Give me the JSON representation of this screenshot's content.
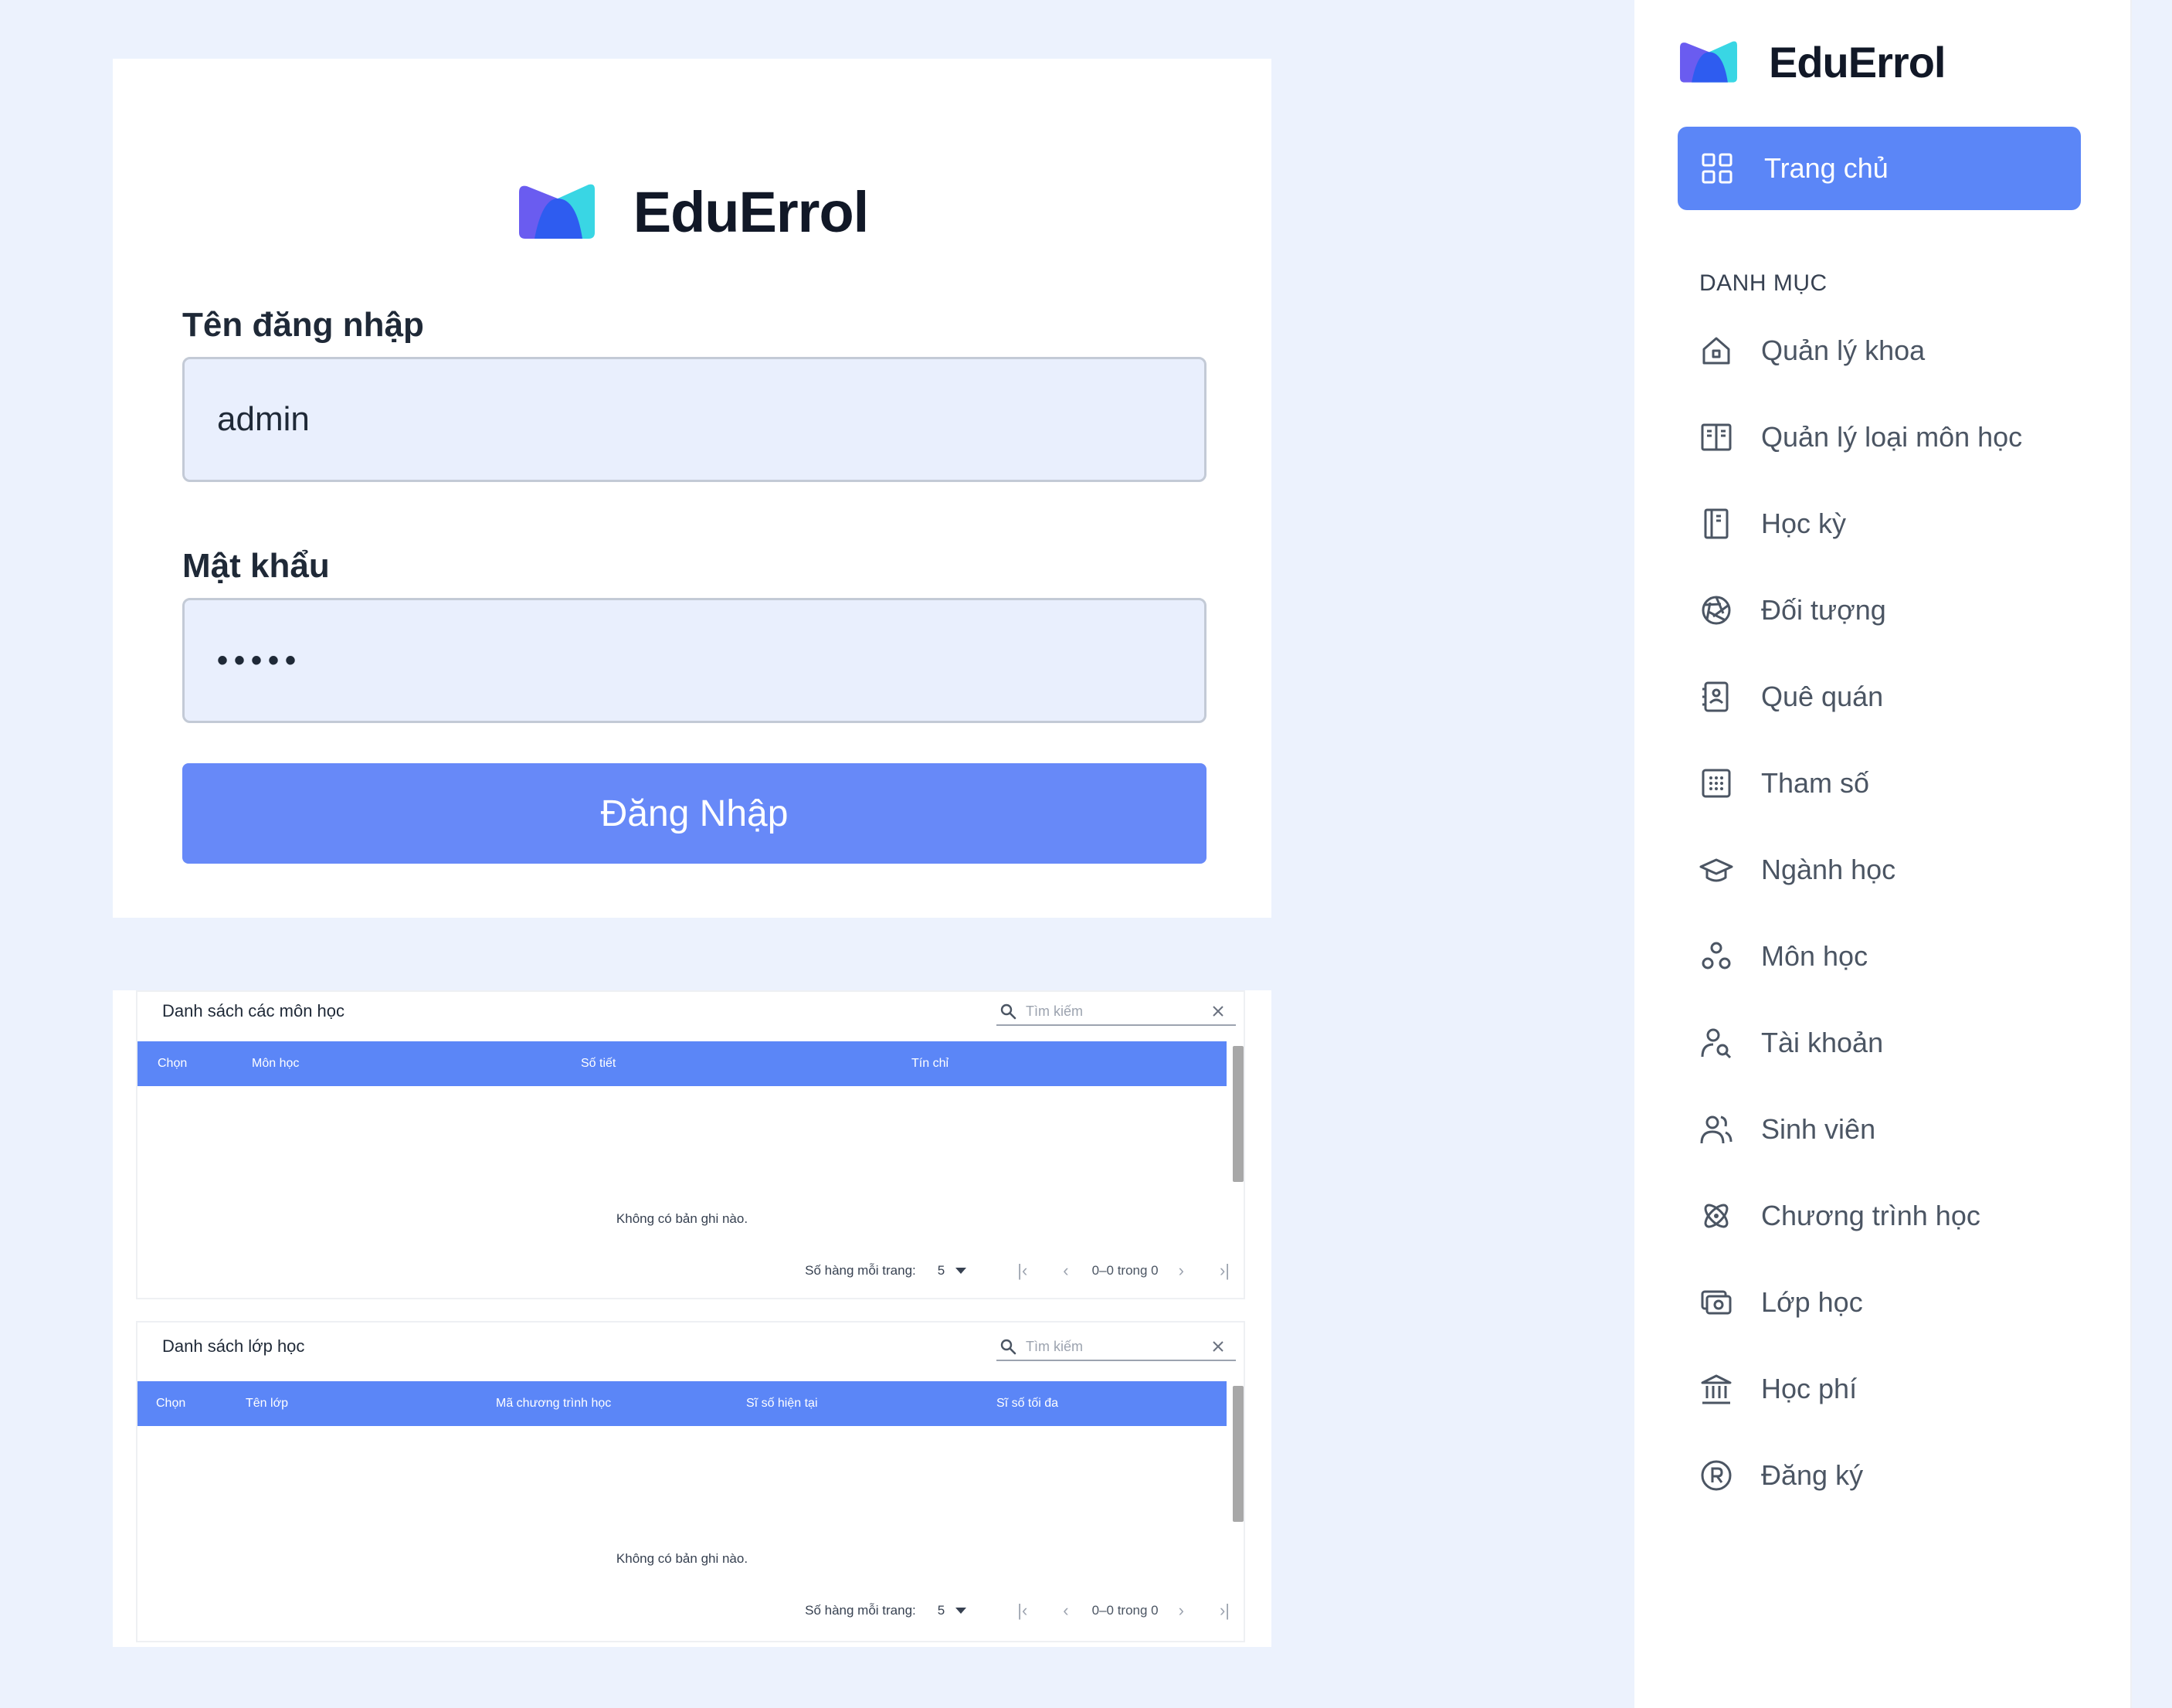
{
  "brand": {
    "name": "EduErrol"
  },
  "login": {
    "username_label": "Tên đăng nhập",
    "username_value": "admin",
    "password_label": "Mật khẩu",
    "password_value": "•••••",
    "submit_label": "Đăng Nhập"
  },
  "subjects_table": {
    "title": "Danh sách các môn học",
    "search_placeholder": "Tìm kiếm",
    "columns": [
      "Chọn",
      "Môn học",
      "Số tiết",
      "Tín chỉ"
    ],
    "empty_message": "Không có bản ghi nào.",
    "rows_per_page_label": "Số hàng mỗi trang:",
    "rows_per_page_value": "5",
    "range_text": "0–0 trong 0"
  },
  "classes_table": {
    "title": "Danh sách lớp học",
    "search_placeholder": "Tìm kiếm",
    "columns": [
      "Chọn",
      "Tên lớp",
      "Mã chương trình học",
      "Sĩ số hiện tại",
      "Sĩ số tối đa"
    ],
    "empty_message": "Không có bản ghi nào.",
    "rows_per_page_label": "Số hàng mỗi trang:",
    "rows_per_page_value": "5",
    "range_text": "0–0 trong 0"
  },
  "sidebar": {
    "home_label": "Trang chủ",
    "section_label": "DANH MỤC",
    "items": [
      {
        "label": "Quản lý khoa",
        "icon": "home-icon"
      },
      {
        "label": "Quản lý loại môn học",
        "icon": "book-open-icon"
      },
      {
        "label": "Học kỳ",
        "icon": "notebook-icon"
      },
      {
        "label": "Đối tượng",
        "icon": "aperture-icon"
      },
      {
        "label": "Quê quán",
        "icon": "contact-book-icon"
      },
      {
        "label": "Tham số",
        "icon": "grid-dots-icon"
      },
      {
        "label": "Ngành học",
        "icon": "graduation-cap-icon"
      },
      {
        "label": "Môn học",
        "icon": "shapes-icon"
      },
      {
        "label": "Tài khoản",
        "icon": "user-search-icon"
      },
      {
        "label": "Sinh viên",
        "icon": "users-icon"
      },
      {
        "label": "Chương trình học",
        "icon": "atom-icon"
      },
      {
        "label": "Lớp học",
        "icon": "money-cards-icon"
      },
      {
        "label": "Học phí",
        "icon": "bank-icon"
      },
      {
        "label": "Đăng ký",
        "icon": "registered-icon"
      }
    ]
  },
  "colors": {
    "page_background": "#ecf2fd",
    "accent": "#5b86f7",
    "login_button": "#6789f8",
    "input_fill": "#e9effd"
  }
}
